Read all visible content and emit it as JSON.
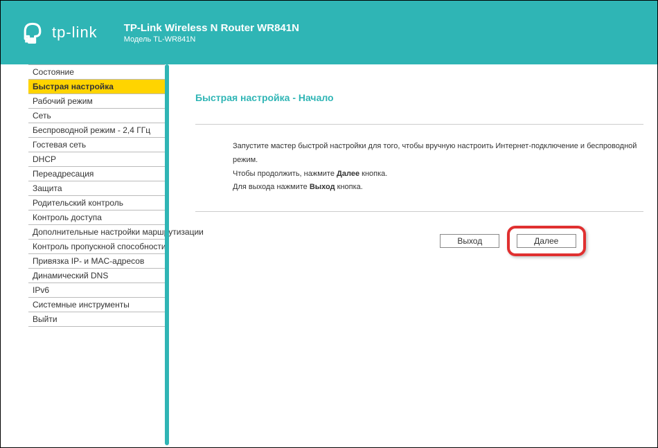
{
  "header": {
    "brand": "tp-link",
    "title": "TP-Link Wireless N Router WR841N",
    "model": "Модель TL-WR841N"
  },
  "sidebar": {
    "items": [
      {
        "label": "Состояние",
        "active": false
      },
      {
        "label": "Быстрая настройка",
        "active": true
      },
      {
        "label": "Рабочий режим",
        "active": false
      },
      {
        "label": "Сеть",
        "active": false
      },
      {
        "label": "Беспроводной режим - 2,4 ГГц",
        "active": false
      },
      {
        "label": "Гостевая сеть",
        "active": false
      },
      {
        "label": "DHCP",
        "active": false
      },
      {
        "label": "Переадресация",
        "active": false
      },
      {
        "label": "Защита",
        "active": false
      },
      {
        "label": "Родительский контроль",
        "active": false
      },
      {
        "label": "Контроль доступа",
        "active": false
      },
      {
        "label": "Дополнительные настройки маршрутизации",
        "active": false
      },
      {
        "label": "Контроль пропускной способности",
        "active": false
      },
      {
        "label": "Привязка IP- и MAC-адресов",
        "active": false
      },
      {
        "label": "Динамический DNS",
        "active": false
      },
      {
        "label": "IPv6",
        "active": false
      },
      {
        "label": "Системные инструменты",
        "active": false
      },
      {
        "label": "Выйти",
        "active": false
      }
    ]
  },
  "content": {
    "page_title": "Быстрая настройка - Начало",
    "line1": "Запустите мастер быстрой настройки для того, чтобы вручную настроить Интернет-подключение и беспроводной режим.",
    "line2_pre": "Чтобы продолжить, нажмите ",
    "line2_bold": "Далее",
    "line2_post": " кнопка.",
    "line3_pre": "Для выхода нажмите ",
    "line3_bold": "Выход",
    "line3_post": " кнопка.",
    "btn_exit": "Выход",
    "btn_next": "Далее"
  }
}
